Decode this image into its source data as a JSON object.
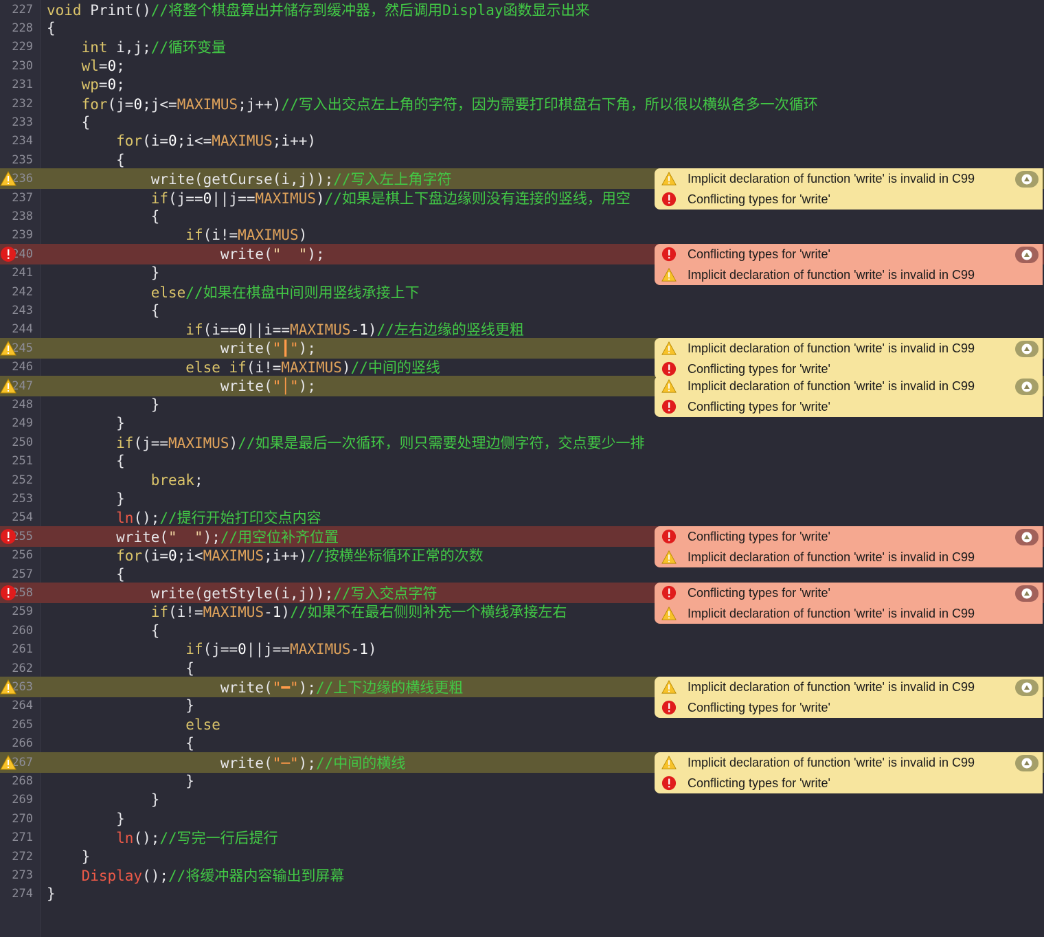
{
  "editor": {
    "lines": [
      {
        "n": "227",
        "state": "none",
        "segs": [
          [
            "kw",
            "void "
          ],
          [
            "",
            "Print()"
          ],
          [
            "cmt",
            "//将整个棋盘算出并储存到缓冲器，然后调用Display函数显示出来"
          ]
        ]
      },
      {
        "n": "228",
        "state": "none",
        "segs": [
          [
            "",
            "{"
          ]
        ]
      },
      {
        "n": "229",
        "state": "none",
        "segs": [
          [
            "",
            "    "
          ],
          [
            "kw",
            "int "
          ],
          [
            "",
            "i,j;"
          ],
          [
            "cmt",
            "//循环变量"
          ]
        ]
      },
      {
        "n": "230",
        "state": "none",
        "segs": [
          [
            "",
            "    "
          ],
          [
            "kw",
            "wl"
          ],
          [
            "",
            "="
          ],
          [
            "num",
            "0"
          ],
          [
            "",
            ";"
          ]
        ]
      },
      {
        "n": "231",
        "state": "none",
        "segs": [
          [
            "",
            "    "
          ],
          [
            "kw",
            "wp"
          ],
          [
            "",
            "="
          ],
          [
            "num",
            "0"
          ],
          [
            "",
            ";"
          ]
        ]
      },
      {
        "n": "232",
        "state": "none",
        "segs": [
          [
            "",
            "    "
          ],
          [
            "kw",
            "for"
          ],
          [
            "",
            "(j="
          ],
          [
            "num",
            "0"
          ],
          [
            "",
            ";j<="
          ],
          [
            "mac",
            "MAXIMUS"
          ],
          [
            "",
            ";j++)"
          ],
          [
            "cmt",
            "//写入出交点左上角的字符，因为需要打印棋盘右下角，所以很以横纵各多一次循环"
          ]
        ]
      },
      {
        "n": "233",
        "state": "none",
        "segs": [
          [
            "",
            "    {"
          ]
        ]
      },
      {
        "n": "234",
        "state": "none",
        "segs": [
          [
            "",
            "        "
          ],
          [
            "kw",
            "for"
          ],
          [
            "",
            "(i="
          ],
          [
            "num",
            "0"
          ],
          [
            "",
            ";i<="
          ],
          [
            "mac",
            "MAXIMUS"
          ],
          [
            "",
            ";i++)"
          ]
        ]
      },
      {
        "n": "235",
        "state": "none",
        "segs": [
          [
            "",
            "        {"
          ]
        ]
      },
      {
        "n": "236",
        "state": "warn",
        "segs": [
          [
            "",
            "            write(getCurse(i,j));"
          ],
          [
            "cmt",
            "//写入左上角字符"
          ]
        ]
      },
      {
        "n": "237",
        "state": "none",
        "segs": [
          [
            "",
            "            "
          ],
          [
            "kw",
            "if"
          ],
          [
            "",
            "(j=="
          ],
          [
            "num",
            "0"
          ],
          [
            "",
            "||j=="
          ],
          [
            "mac",
            "MAXIMUS"
          ],
          [
            "",
            ")"
          ],
          [
            "cmt",
            "//如果是棋上下盘边缘则没有连接的竖线，用空"
          ]
        ]
      },
      {
        "n": "238",
        "state": "none",
        "segs": [
          [
            "",
            "            {"
          ]
        ]
      },
      {
        "n": "239",
        "state": "none",
        "segs": [
          [
            "",
            "                "
          ],
          [
            "kw",
            "if"
          ],
          [
            "",
            "(i!="
          ],
          [
            "mac",
            "MAXIMUS"
          ],
          [
            "",
            ")"
          ]
        ]
      },
      {
        "n": "240",
        "state": "err",
        "segs": [
          [
            "",
            "                    write("
          ],
          [
            "str",
            "\"  \""
          ],
          [
            "",
            ");"
          ]
        ]
      },
      {
        "n": "241",
        "state": "none",
        "segs": [
          [
            "",
            "            }"
          ]
        ]
      },
      {
        "n": "242",
        "state": "none",
        "segs": [
          [
            "",
            "            "
          ],
          [
            "kw",
            "else"
          ],
          [
            "cmt",
            "//如果在棋盘中间则用竖线承接上下"
          ]
        ]
      },
      {
        "n": "243",
        "state": "none",
        "segs": [
          [
            "",
            "            {"
          ]
        ]
      },
      {
        "n": "244",
        "state": "none",
        "segs": [
          [
            "",
            "                "
          ],
          [
            "kw",
            "if"
          ],
          [
            "",
            "(i=="
          ],
          [
            "num",
            "0"
          ],
          [
            "",
            "||i=="
          ],
          [
            "mac",
            "MAXIMUS"
          ],
          [
            "",
            "-"
          ],
          [
            "num",
            "1"
          ],
          [
            "",
            ")"
          ],
          [
            "cmt",
            "//左右边缘的竖线更粗"
          ]
        ]
      },
      {
        "n": "245",
        "state": "warn",
        "segs": [
          [
            "",
            "                    write("
          ],
          [
            "strv",
            "\"┃\""
          ],
          [
            "",
            ");"
          ]
        ]
      },
      {
        "n": "246",
        "state": "none",
        "segs": [
          [
            "",
            "                "
          ],
          [
            "kw",
            "else if"
          ],
          [
            "",
            "(i!="
          ],
          [
            "mac",
            "MAXIMUS"
          ],
          [
            "",
            ")"
          ],
          [
            "cmt",
            "//中间的竖线"
          ]
        ]
      },
      {
        "n": "247",
        "state": "warn",
        "segs": [
          [
            "",
            "                    write("
          ],
          [
            "strv",
            "\"│\""
          ],
          [
            "",
            ");"
          ]
        ]
      },
      {
        "n": "248",
        "state": "none",
        "segs": [
          [
            "",
            "            }"
          ]
        ]
      },
      {
        "n": "249",
        "state": "none",
        "segs": [
          [
            "",
            "        }"
          ]
        ]
      },
      {
        "n": "250",
        "state": "none",
        "segs": [
          [
            "",
            "        "
          ],
          [
            "kw",
            "if"
          ],
          [
            "",
            "(j=="
          ],
          [
            "mac",
            "MAXIMUS"
          ],
          [
            "",
            ")"
          ],
          [
            "cmt",
            "//如果是最后一次循环，则只需要处理边侧字符，交点要少一排"
          ]
        ]
      },
      {
        "n": "251",
        "state": "none",
        "segs": [
          [
            "",
            "        {"
          ]
        ]
      },
      {
        "n": "252",
        "state": "none",
        "segs": [
          [
            "",
            "            "
          ],
          [
            "kw",
            "break"
          ],
          [
            "",
            ";"
          ]
        ]
      },
      {
        "n": "253",
        "state": "none",
        "segs": [
          [
            "",
            "        }"
          ]
        ]
      },
      {
        "n": "254",
        "state": "none",
        "segs": [
          [
            "",
            "        "
          ],
          [
            "fn",
            "ln"
          ],
          [
            "",
            "();"
          ],
          [
            "cmt",
            "//提行开始打印交点内容"
          ]
        ]
      },
      {
        "n": "255",
        "state": "err",
        "segs": [
          [
            "",
            "        write("
          ],
          [
            "str",
            "\"  \""
          ],
          [
            "",
            ");"
          ],
          [
            "cmt",
            "//用空位补齐位置"
          ]
        ]
      },
      {
        "n": "256",
        "state": "none",
        "segs": [
          [
            "",
            "        "
          ],
          [
            "kw",
            "for"
          ],
          [
            "",
            "(i="
          ],
          [
            "num",
            "0"
          ],
          [
            "",
            ";i<"
          ],
          [
            "mac",
            "MAXIMUS"
          ],
          [
            "",
            ";i++)"
          ],
          [
            "cmt",
            "//按横坐标循环正常的次数"
          ]
        ]
      },
      {
        "n": "257",
        "state": "none",
        "segs": [
          [
            "",
            "        {"
          ]
        ]
      },
      {
        "n": "258",
        "state": "err",
        "segs": [
          [
            "",
            "            write(getStyle(i,j));"
          ],
          [
            "cmt",
            "//写入交点字符"
          ]
        ]
      },
      {
        "n": "259",
        "state": "none",
        "segs": [
          [
            "",
            "            "
          ],
          [
            "kw",
            "if"
          ],
          [
            "",
            "(i!="
          ],
          [
            "mac",
            "MAXIMUS"
          ],
          [
            "",
            "-"
          ],
          [
            "num",
            "1"
          ],
          [
            "",
            ")"
          ],
          [
            "cmt",
            "//如果不在最右侧则补充一个横线承接左右"
          ]
        ]
      },
      {
        "n": "260",
        "state": "none",
        "segs": [
          [
            "",
            "            {"
          ]
        ]
      },
      {
        "n": "261",
        "state": "none",
        "segs": [
          [
            "",
            "                "
          ],
          [
            "kw",
            "if"
          ],
          [
            "",
            "(j=="
          ],
          [
            "num",
            "0"
          ],
          [
            "",
            "||j=="
          ],
          [
            "mac",
            "MAXIMUS"
          ],
          [
            "",
            "-"
          ],
          [
            "num",
            "1"
          ],
          [
            "",
            ")"
          ]
        ]
      },
      {
        "n": "262",
        "state": "none",
        "segs": [
          [
            "",
            "                {"
          ]
        ]
      },
      {
        "n": "263",
        "state": "warn",
        "segs": [
          [
            "",
            "                    write("
          ],
          [
            "strv",
            "\"━\""
          ],
          [
            "",
            ");"
          ],
          [
            "cmt",
            "//上下边缘的横线更粗"
          ]
        ]
      },
      {
        "n": "264",
        "state": "none",
        "segs": [
          [
            "",
            "                }"
          ]
        ]
      },
      {
        "n": "265",
        "state": "none",
        "segs": [
          [
            "",
            "                "
          ],
          [
            "kw",
            "else"
          ]
        ]
      },
      {
        "n": "266",
        "state": "none",
        "segs": [
          [
            "",
            "                {"
          ]
        ]
      },
      {
        "n": "267",
        "state": "warn",
        "segs": [
          [
            "",
            "                    write("
          ],
          [
            "strv",
            "\"─\""
          ],
          [
            "",
            ");"
          ],
          [
            "cmt",
            "//中间的横线"
          ]
        ]
      },
      {
        "n": "268",
        "state": "none",
        "segs": [
          [
            "",
            "                }"
          ]
        ]
      },
      {
        "n": "269",
        "state": "none",
        "segs": [
          [
            "",
            "            }"
          ]
        ]
      },
      {
        "n": "270",
        "state": "none",
        "segs": [
          [
            "",
            "        }"
          ]
        ]
      },
      {
        "n": "271",
        "state": "none",
        "segs": [
          [
            "",
            "        "
          ],
          [
            "fn",
            "ln"
          ],
          [
            "",
            "();"
          ],
          [
            "cmt",
            "//写完一行后提行"
          ]
        ]
      },
      {
        "n": "272",
        "state": "none",
        "segs": [
          [
            "",
            "    }"
          ]
        ]
      },
      {
        "n": "273",
        "state": "none",
        "segs": [
          [
            "",
            "    "
          ],
          [
            "fn",
            "Display"
          ],
          [
            "",
            "();"
          ],
          [
            "cmt",
            "//将缓冲器内容输出到屏幕"
          ]
        ]
      },
      {
        "n": "274",
        "state": "none",
        "segs": [
          [
            "",
            "}"
          ]
        ]
      }
    ]
  },
  "annotations": [
    {
      "line": "236",
      "box": "warn",
      "items": [
        {
          "kind": "warning",
          "text": "Implicit declaration of function 'write' is invalid in C99"
        },
        {
          "kind": "error",
          "text": "Conflicting types for 'write'"
        }
      ]
    },
    {
      "line": "240",
      "box": "err",
      "items": [
        {
          "kind": "error",
          "text": "Conflicting types for 'write'"
        },
        {
          "kind": "warning",
          "text": "Implicit declaration of function 'write' is invalid in C99"
        }
      ]
    },
    {
      "line": "245",
      "box": "warn",
      "items": [
        {
          "kind": "warning",
          "text": "Implicit declaration of function 'write' is invalid in C99"
        },
        {
          "kind": "error",
          "text": "Conflicting types for 'write'"
        }
      ]
    },
    {
      "line": "247",
      "box": "warn",
      "items": [
        {
          "kind": "warning",
          "text": "Implicit declaration of function 'write' is invalid in C99"
        },
        {
          "kind": "error",
          "text": "Conflicting types for 'write'"
        }
      ]
    },
    {
      "line": "255",
      "box": "err",
      "items": [
        {
          "kind": "error",
          "text": "Conflicting types for 'write'"
        },
        {
          "kind": "warning",
          "text": "Implicit declaration of function 'write' is invalid in C99"
        }
      ]
    },
    {
      "line": "258",
      "box": "err",
      "items": [
        {
          "kind": "error",
          "text": "Conflicting types for 'write'"
        },
        {
          "kind": "warning",
          "text": "Implicit declaration of function 'write' is invalid in C99"
        }
      ]
    },
    {
      "line": "263",
      "box": "warn",
      "items": [
        {
          "kind": "warning",
          "text": "Implicit declaration of function 'write' is invalid in C99"
        },
        {
          "kind": "error",
          "text": "Conflicting types for 'write'"
        }
      ]
    },
    {
      "line": "267",
      "box": "warn",
      "items": [
        {
          "kind": "warning",
          "text": "Implicit declaration of function 'write' is invalid in C99"
        },
        {
          "kind": "error",
          "text": "Conflicting types for 'write'"
        }
      ]
    }
  ],
  "icons": {
    "warning": "warning-triangle-icon",
    "error": "error-circle-icon",
    "collapse": "caret-up-icon"
  }
}
